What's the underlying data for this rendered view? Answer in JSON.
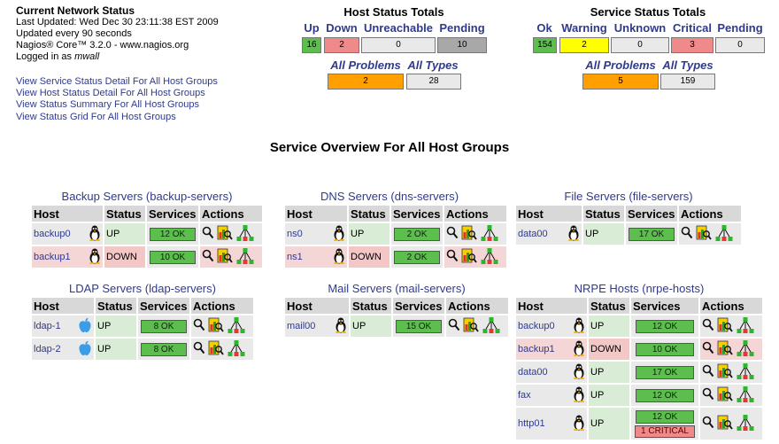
{
  "info": {
    "title": "Current Network Status",
    "last_updated": "Last Updated: Wed Dec 30 23:11:38 EST 2009",
    "interval": "Updated every 90 seconds",
    "version": "Nagios® Core™ 3.2.0 - www.nagios.org",
    "logged_prefix": "Logged in as ",
    "user": "mwall"
  },
  "links": [
    "View Service Status Detail For All Host Groups",
    "View Host Status Detail For All Host Groups",
    "View Status Summary For All Host Groups",
    "View Status Grid For All Host Groups"
  ],
  "host_totals": {
    "title": "Host Status Totals",
    "headers": [
      "Up",
      "Down",
      "Unreachable",
      "Pending"
    ],
    "values": [
      "16",
      "2",
      "0",
      "10"
    ],
    "colors": [
      "#5cbf4d",
      "#f08a8a",
      "#e9e9e9",
      "#a8a8a8"
    ],
    "problems_label": "All Problems",
    "types_label": "All Types",
    "problems": "2",
    "types": "28",
    "problems_color": "#ffa000"
  },
  "service_totals": {
    "title": "Service Status Totals",
    "headers": [
      "Ok",
      "Warning",
      "Unknown",
      "Critical",
      "Pending"
    ],
    "values": [
      "154",
      "2",
      "0",
      "3",
      "0"
    ],
    "colors": [
      "#5cbf4d",
      "#ffff00",
      "#e9e9e9",
      "#f08a8a",
      "#e9e9e9"
    ],
    "problems_label": "All Problems",
    "types_label": "All Types",
    "problems": "5",
    "types": "159",
    "problems_color": "#ffa000"
  },
  "overview_title": "Service Overview For All Host Groups",
  "table_headers": {
    "host": "Host",
    "status": "Status",
    "services": "Services",
    "actions": "Actions"
  },
  "groups": [
    {
      "title": "Backup Servers",
      "alias": "backup-servers",
      "hosts": [
        {
          "name": "backup0",
          "os": "linux",
          "status": "UP",
          "ok": "12 OK"
        },
        {
          "name": "backup1",
          "os": "linux",
          "status": "DOWN",
          "ok": "10 OK"
        }
      ]
    },
    {
      "title": "DNS Servers",
      "alias": "dns-servers",
      "hosts": [
        {
          "name": "ns0",
          "os": "linux",
          "status": "UP",
          "ok": "2 OK"
        },
        {
          "name": "ns1",
          "os": "linux",
          "status": "DOWN",
          "ok": "2 OK"
        }
      ]
    },
    {
      "title": "File Servers",
      "alias": "file-servers",
      "hosts": [
        {
          "name": "data00",
          "os": "linux",
          "status": "UP",
          "ok": "17 OK"
        }
      ]
    },
    {
      "title": "LDAP Servers",
      "alias": "ldap-servers",
      "hosts": [
        {
          "name": "ldap-1",
          "os": "apple",
          "status": "UP",
          "ok": "8 OK"
        },
        {
          "name": "ldap-2",
          "os": "apple",
          "status": "UP",
          "ok": "8 OK"
        }
      ]
    },
    {
      "title": "Mail Servers",
      "alias": "mail-servers",
      "hosts": [
        {
          "name": "mail00",
          "os": "linux",
          "status": "UP",
          "ok": "15 OK"
        }
      ]
    },
    {
      "title": "NRPE Hosts",
      "alias": "nrpe-hosts",
      "hosts": [
        {
          "name": "backup0",
          "os": "linux",
          "status": "UP",
          "ok": "12 OK"
        },
        {
          "name": "backup1",
          "os": "linux",
          "status": "DOWN",
          "ok": "10 OK"
        },
        {
          "name": "data00",
          "os": "linux",
          "status": "UP",
          "ok": "17 OK"
        },
        {
          "name": "fax",
          "os": "linux",
          "status": "UP",
          "ok": "12 OK"
        },
        {
          "name": "http01",
          "os": "linux",
          "status": "UP",
          "ok": "12 OK",
          "critical": "1 CRITICAL"
        }
      ]
    }
  ],
  "icons": {
    "linux": "tux-penguin-icon",
    "apple": "apple-logo-icon",
    "search": "magnifier-icon",
    "detail": "host-detail-icon",
    "map": "status-map-icon"
  }
}
